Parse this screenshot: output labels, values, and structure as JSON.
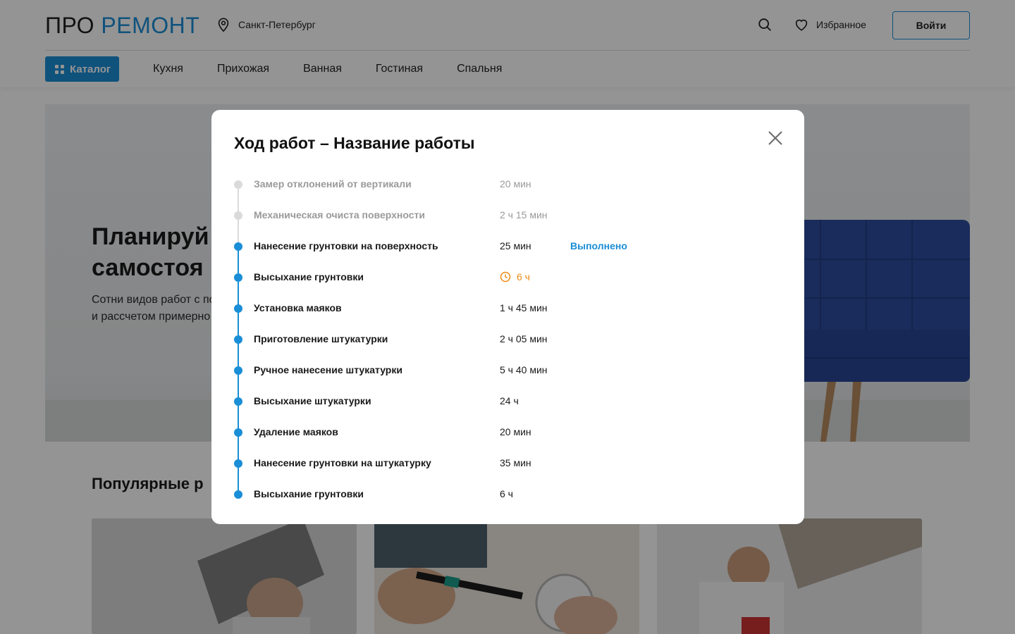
{
  "header": {
    "logo_part1": "ПРО",
    "logo_part2": "РЕМОНТ",
    "city": "Санкт-Петербург",
    "favorites_label": "Избранное",
    "login_label": "Войти"
  },
  "nav": {
    "catalog_label": "Каталог",
    "items": [
      "Кухня",
      "Прихожая",
      "Ванная",
      "Гостиная",
      "Спальня"
    ]
  },
  "hero": {
    "title_line1": "Планируй",
    "title_line2": "самостоя",
    "subtitle_line1": "Сотни видов работ с по",
    "subtitle_line2": "и рассчетом примерно"
  },
  "popular": {
    "title": "Популярные р"
  },
  "modal": {
    "title": "Ход работ – Название работы",
    "steps": [
      {
        "name": "Замер отклонений от вертикали",
        "duration": "20 мин",
        "state": "done"
      },
      {
        "name": "Механическая очиста поверхности",
        "duration": "2 ч 15 мин",
        "state": "done"
      },
      {
        "name": "Нанесение грунтовки на поверхность",
        "duration": "25 мин",
        "state": "active",
        "status": "Выполнено"
      },
      {
        "name": "Высыхание грунтовки",
        "duration": "6 ч",
        "state": "waiting"
      },
      {
        "name": "Установка маяков",
        "duration": "1 ч 45 мин",
        "state": "pending"
      },
      {
        "name": "Приготовление штукатурки",
        "duration": "2 ч 05 мин",
        "state": "pending"
      },
      {
        "name": "Ручное нанесение штукатурки",
        "duration": "5 ч 40 мин",
        "state": "pending"
      },
      {
        "name": "Высыхание штукатурки",
        "duration": "24 ч",
        "state": "pending"
      },
      {
        "name": "Удаление маяков",
        "duration": "20 мин",
        "state": "pending"
      },
      {
        "name": "Нанесение грунтовки на штукатурку",
        "duration": "35 мин",
        "state": "pending"
      },
      {
        "name": "Высыхание грунтовки",
        "duration": "6 ч",
        "state": "pending"
      }
    ]
  },
  "colors": {
    "accent": "#1a8ed6",
    "warning": "#f08a14",
    "done_grey": "#dadada"
  },
  "icons": [
    "location-pin-icon",
    "search-icon",
    "heart-icon",
    "grid-icon",
    "close-icon",
    "clock-icon"
  ]
}
